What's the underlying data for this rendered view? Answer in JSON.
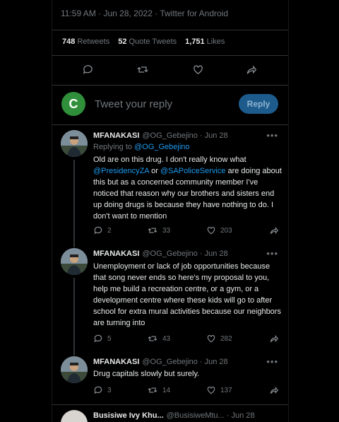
{
  "tweet_meta": {
    "timestamp": "11:59 AM · Jun 28, 2022 · Twitter for Android"
  },
  "stats": {
    "retweets_count": "748",
    "retweets_label": "Retweets",
    "quotes_count": "52",
    "quotes_label": "Quote Tweets",
    "likes_count": "1,751",
    "likes_label": "Likes"
  },
  "compose": {
    "avatar_letter": "C",
    "placeholder": "Tweet your reply",
    "reply_button": "Reply",
    "avatar_color": "#2f8f3a"
  },
  "replies": [
    {
      "name": "MFANAKASI",
      "handle": "@OG_Gebejino · Jun 28",
      "replying_prefix": "Replying to ",
      "replying_to": "@OG_Gebejino",
      "text_a": "Old are on this drug. I don't really know what",
      "mention1": "@PresidencyZA",
      "mid": " or ",
      "mention2": "@SAPoliceService",
      "text_b": " are doing",
      "text_c": "about this but as a concerned community member I've noticed that reason why our brothers and sisters end up doing drugs is because they have nothing to do. I don't want to mention",
      "replies": "2",
      "retweets": "33",
      "likes": "203"
    },
    {
      "name": "MFANAKASI",
      "handle": "@OG_Gebejino · Jun 28",
      "text": "Unemployment or lack of job opportunities because that song never ends so here's my proposal to you, help me build a recreation centre, or a gym, or a development centre where these kids will go to after school for extra mural activities because our neighbors are turning into",
      "replies": "5",
      "retweets": "43",
      "likes": "282"
    },
    {
      "name": "MFANAKASI",
      "handle": "@OG_Gebejino · Jun 28",
      "text": "Drug capitals slowly but surely.",
      "replies": "3",
      "retweets": "14",
      "likes": "137"
    },
    {
      "name": "Busisiwe Ivy Khu...",
      "handle": "@BusisiweMtu... · Jun 28"
    }
  ],
  "colors": {
    "accent": "#1d9bf0",
    "muted": "#71767b",
    "background": "#000000"
  }
}
